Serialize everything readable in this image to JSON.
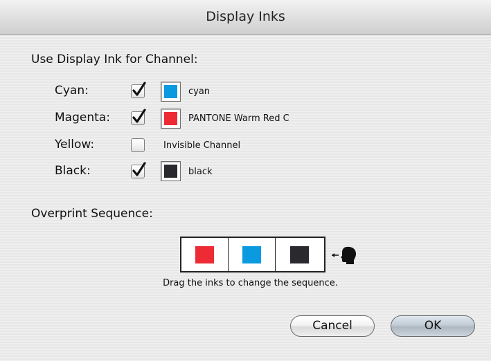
{
  "window": {
    "title": "Display Inks"
  },
  "channels_section": {
    "heading": "Use Display Ink for Channel:"
  },
  "channels": [
    {
      "label": "Cyan:",
      "checked": true,
      "color": "#0a9ae0",
      "ink": "cyan"
    },
    {
      "label": "Magenta:",
      "checked": true,
      "color": "#ee2b35",
      "ink": "PANTONE Warm Red C"
    },
    {
      "label": "Yellow:",
      "checked": false,
      "color": null,
      "ink": "Invisible Channel"
    },
    {
      "label": "Black:",
      "checked": true,
      "color": "#2a2a2e",
      "ink": "black"
    }
  ],
  "overprint": {
    "heading": "Overprint Sequence:",
    "sequence": [
      {
        "ink": "PANTONE Warm Red C",
        "color": "#ee2b35"
      },
      {
        "ink": "cyan",
        "color": "#0a9ae0"
      },
      {
        "ink": "black",
        "color": "#2a2a2e"
      }
    ],
    "viewer_icon": "viewer-head-icon",
    "hint": "Drag the inks to change the sequence."
  },
  "buttons": {
    "cancel": "Cancel",
    "ok": "OK"
  }
}
